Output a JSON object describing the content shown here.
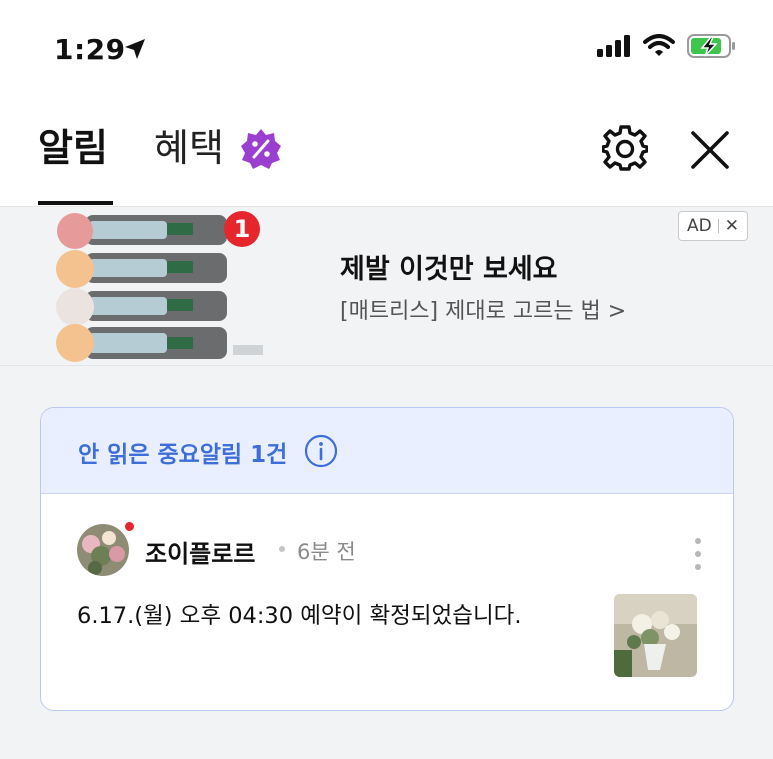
{
  "status_bar": {
    "time": "1:29"
  },
  "header": {
    "tabs": [
      {
        "label": "알림"
      },
      {
        "label": "혜택"
      }
    ]
  },
  "ad": {
    "badge_count": "1",
    "title": "제발 이것만 보세요",
    "subtitle": "[매트리스] 제대로 고르는 법 >",
    "tag": "AD",
    "close_glyph": "✕"
  },
  "notice": {
    "header": "안 읽은 중요알림 1건",
    "item": {
      "sender": "조이플로르",
      "time_ago": "6분 전",
      "message": "6.17.(월) 오후 04:30 예약이 확정되었습니다."
    }
  },
  "colors": {
    "accent_blue": "#3e6fd8",
    "badge_red": "#e5262c",
    "benefit_purple": "#9b3fd0"
  },
  "icons": [
    "location-arrow-icon",
    "cellular-signal-icon",
    "wifi-icon",
    "battery-charging-icon",
    "percent-badge-icon",
    "gear-icon",
    "close-icon",
    "info-icon",
    "kebab-menu-icon"
  ]
}
